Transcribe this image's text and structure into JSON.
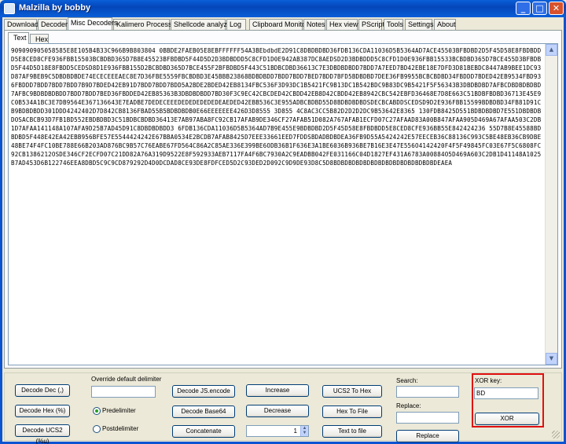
{
  "window": {
    "title": "Malzilla by bobby",
    "minimize": "_",
    "maximize": "□",
    "close": "✕"
  },
  "main_tabs": [
    "Download",
    "Decoder",
    "Misc Decoders",
    "Kalimero Processor",
    "Shellcode analyzer",
    "Log",
    "Clipboard Monitor",
    "Notes",
    "Hex view",
    "PScript",
    "Tools",
    "Settings",
    "About"
  ],
  "sub_tabs": [
    "Text",
    "Hex"
  ],
  "editor": {
    "content": "909090905058585E8E105B4B33C966B9B803804 0BBDE2FAEB05E8EBFFFFFF54A3BEbdbdE2D91C8DBDBDBD36FDB136CDA11036D5B5364AD7ACE45503BFBDBD2D5F45D58E8FBDBDDD5E8CED8CFE936FBB15503BCBDBD365D7B8E45523BFBDBD5F44D5D2D3BDBDDD5C8CFD1D0E942AB387DC8AEDSD2D3BDBDDD5C8CFD1D0E936FBB15533BCBDBD365D7BCE455D3BFBDBD5F44D5D18E8FBDD5CEDSD8D1E936FBB155D2BCBDBD365D7BCE455F2BFBDBD5F443C51BDBCDBD36613C7E3DBDBDBDD7BDD7A7EED7BD42EBE18E7DFD3D81BEBDC8447AB9BEE1DC93D87AF9BEB9C5DBDBDBDE74ECECEEEAEC8E7D36FBE5559FBCBDBD3E45BBB23868BDBDBDD7BDD7BDD7BED7BDD7BFD5BDBDBD7DEE36FB9955BCBCBDBD34FBDDD7BDED42EB9534FBD936FBDDD7BDD7BDD7BDD7B9D7BDED42EB91D7BDD7BDD7BDD5A2BDE2BDED42EB8134FBC536F3D93DC1B5421FC9B13DC1B542BDC9B83DC9B5421F5F56343B3DBDBDBD7AFBCDBDBDBDBD7AFBC9BDBDBDBDD7BDD7BDD7BED36FBDDED42EB85363B3DBDBDBDD7BD30F3C9EC42CBCDED42CBDD42EB8D42CBDD42EB8942CBC542EBFD36468E7D8E663C51BDBFBDBD36713E45E9C0B534A1BC3E7DB9564E367136643E7EADBE7DEDECEEEDEDEDEDEDEDEAEDED42EBB536C3E955ADBCBDBD55D8BDBDBDBDSDECBCABDDSCEDSD9D2E936FBB15599BDBDBD34FB81D91CB9BDBDBDD301DDD4242402D7D842CB8136FBAD55B5BDBDBDB0E66EEEEEEE426D3D8555 3D855 4C8AC3CC5B82D2D2D2DC9B53642E8365 130FDB8425D551BDBDBDBD7E551DBDBDBDOSACBCB93D7FB1BD552EBDBDBD3C51BDBCBDBD36413E7AB97ABA8FC92CB17AFAB9DE346CF27AFAB51D082A767AFAB1ECFD07C27AFAAD83A00B847AFAA905D469A67AFAA503C2DB1D7AFAA141148A107AFA9D25B7AD45D91C8DBDBDBDD3 6FDB136CDA11036D5B5364AD7B9E455E9BDBDBD2D5F45D58E8FBDBDD5E8CED8CFE936BB55E842424236 55D7B8E45588BDBDBD5F448E42EA42EBB956BFE57E5544424242E67BBA0534E2BCDB7AFAB8425D7EEE33661EED7FDDSBDADBDBDEA36FB9D55A5424242E57EECEB36C88136C993C5BE48EB36CB9DBE48BE74F4FC10BE788E66B203AD876BC9B57C76EABE67FD564C86A2C85AE336E399BE6ODB36B1F636E3A1BE6036B936BE7B16E3E47E556O4142420F4F5F49845FC03E67F5C6808FC92CB1386212OSDE346CF2ECFD07C21DD82A76A319D9522E8F592933AEB7117FA4F6BC7930A2C9EADBB042FE031166C04D1827EF431A6783A00884O5D469A603C2DB1D41148A1025B7AD453D6B122746EEA8DBD5C9C9CD879292D4D0DCDAD8CE93DE8FDFCED5D2C93DED2D092C9D9DE93D8C5D8BDBDBDBDBDBDBDBDBDBDBDBDBDBDEAEA"
  },
  "controls": {
    "decode_dec": "Decode Dec (,)",
    "decode_hex": "Decode Hex (%)",
    "decode_ucs2": "Decode UCS2 (%u)",
    "override_label": "Override default delimiter",
    "override_value": "",
    "predelimiter": "Predelimiter",
    "postdelimiter": "Postdelimiter",
    "decode_js": "Decode JS.encode",
    "decode_base64": "Decode Base64",
    "concatenate": "Concatenate",
    "increase": "Increase",
    "decrease": "Decrease",
    "spin_value": "1",
    "ucs2_to_hex": "UCS2 To Hex",
    "hex_to_file": "Hex To File",
    "text_to_file": "Text to file",
    "search_label": "Search:",
    "search_value": "",
    "replace_label": "Replace:",
    "replace_value": "",
    "replace_button": "Replace",
    "xor_key_label": "XOR key:",
    "xor_key_value": "BD",
    "xor_button": "XOR"
  },
  "colors": {
    "highlight_border": "#e01010",
    "titlebar": "#0a5fd8"
  }
}
